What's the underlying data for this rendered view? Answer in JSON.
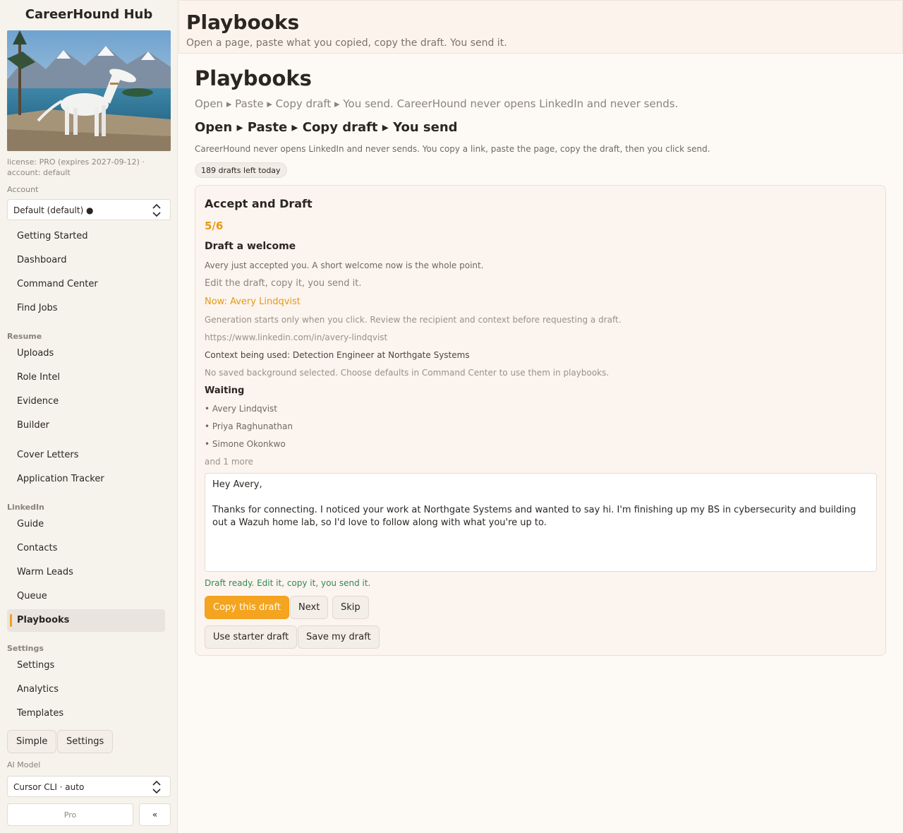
{
  "sidebar": {
    "brand": "CareerHound Hub",
    "license_text": "license: PRO (expires 2027-09-12) · account: default",
    "account_label": "Account",
    "account_value": "Default (default) ●",
    "nav_top": [
      "Getting Started",
      "Dashboard",
      "Command Center",
      "Find Jobs"
    ],
    "resume_label": "Resume",
    "nav_resume": [
      "Uploads",
      "Role Intel",
      "Evidence",
      "Builder",
      "Cover Letters",
      "Application Tracker"
    ],
    "linkedin_label": "LinkedIn",
    "nav_linkedin": [
      "Guide",
      "Contacts",
      "Warm Leads",
      "Queue",
      "Playbooks"
    ],
    "settings_label": "Settings",
    "nav_settings": [
      "Settings",
      "Analytics",
      "Templates"
    ],
    "simple_button": "Simple",
    "settings_button": "Settings",
    "ai_model_label": "AI Model",
    "ai_model_value": "Cursor CLI · auto",
    "pro_button": "Pro",
    "collapse_button": "«",
    "active_item": "Playbooks"
  },
  "header": {
    "title": "Playbooks",
    "subtitle": "Open a page, paste what you copied, copy the draft. You send it."
  },
  "main": {
    "title": "Playbooks",
    "subtitle": "Open ▸ Paste ▸ Copy draft ▸ You send. CareerHound never opens LinkedIn and never sends.",
    "heading": "Open ▸ Paste ▸ Copy draft ▸ You send",
    "description": "CareerHound never opens LinkedIn and never sends. You copy a link, paste the page, copy the draft, then you click send.",
    "badge": "189 drafts left today"
  },
  "card": {
    "title": "Accept and Draft",
    "step": "5/6",
    "heading": "Draft a welcome",
    "line1": "Avery just accepted you. A short welcome now is the whole point.",
    "line2": "Edit the draft, copy it, you send it.",
    "now": "Now: Avery Lindqvist",
    "generation_note": "Generation starts only when you click. Review the recipient and context before requesting a draft.",
    "profile_url": "https://www.linkedin.com/in/avery-lindqvist",
    "context": "Context being used: Detection Engineer at Northgate Systems",
    "background_note": "No saved background selected. Choose defaults in Command Center to use them in playbooks.",
    "waiting_label": "Waiting",
    "waiting": [
      "• Avery Lindqvist",
      "• Priya Raghunathan",
      "• Simone Okonkwo"
    ],
    "more": "and 1 more",
    "draft": "Hey Avery,\n\nThanks for connecting. I noticed your work at Northgate Systems and wanted to say hi. I'm finishing up my BS in cybersecurity and building out a Wazuh home lab, so I'd love to follow along with what you're up to.",
    "status": "Draft ready. Edit it, copy it, you send it.",
    "buttons": {
      "copy": "Copy this draft",
      "next": "Next",
      "skip": "Skip",
      "starter": "Use starter draft",
      "save": "Save my draft"
    }
  },
  "colors": {
    "accent": "#f5a41f",
    "success": "#2e8b57",
    "background": "#fdfaf5"
  }
}
